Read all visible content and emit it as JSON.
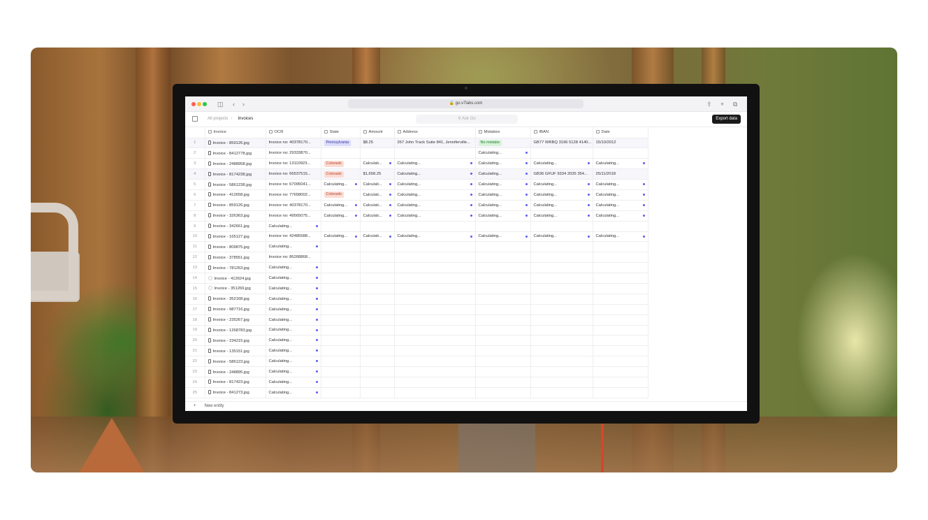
{
  "browser": {
    "url": "go.v7labs.com"
  },
  "app": {
    "breadcrumb": [
      "All projects",
      "Invoices"
    ],
    "ask_placeholder": "Ask Go",
    "export_label": "Export data",
    "new_entity_label": "New entity",
    "add_column": "+"
  },
  "columns": [
    "Invoice",
    "OCR",
    "State",
    "Amount",
    "Address",
    "Mistakes",
    "IBAN",
    "Date"
  ],
  "rows": [
    {
      "n": "1",
      "file": "Invoice - 859126.jpg",
      "ocr": "Invoice no: 40378170...",
      "state": "Pennsylvania",
      "amount": "$8.25",
      "address": "267 John Track Suite 841, Jenniferville...",
      "mistakes": "No mistake",
      "iban": "GB77 WRBQ 3196 5128 4140...",
      "date": "15/10/2012"
    },
    {
      "n": "2",
      "file": "Invoice - 8412778.jpg",
      "ocr": "Invoice no: 29333870...",
      "state": "",
      "amount": "",
      "address": "",
      "mistakes": "Calculating...",
      "iban": "",
      "date": ""
    },
    {
      "n": "3",
      "file": "Invoice - 2488958.jpg",
      "ocr": "Invoice no: 13110923...",
      "state": "Colorado",
      "amount": "Calculati...",
      "address": "Calculating...",
      "mistakes": "Calculating...",
      "iban": "Calculating...",
      "date": "Calculating..."
    },
    {
      "n": "4",
      "file": "Invoice - 8174238.jpg",
      "ocr": "Invoice no: 66537515...",
      "state": "Colorado",
      "amount": "$1,658.25",
      "address": "Calculating...",
      "mistakes": "Calculating...",
      "iban": "GB36 GFUF 9334 2035 354...",
      "date": "25/11/2018"
    },
    {
      "n": "5",
      "file": "Invoice - 5861238.jpg",
      "ocr": "Invoice no: 67095041...",
      "state": "Calculating...",
      "amount": "Calculati...",
      "address": "Calculating...",
      "mistakes": "Calculating...",
      "iban": "Calculating...",
      "date": "Calculating..."
    },
    {
      "n": "6",
      "file": "Invoice - 412658.jpg",
      "ocr": "Invoice no: 77658002...",
      "state": "Colorado",
      "amount": "Calculati...",
      "address": "Calculating...",
      "mistakes": "Calculating...",
      "iban": "Calculating...",
      "date": "Calculating..."
    },
    {
      "n": "7",
      "file": "Invoice - 859126.jpg",
      "ocr": "Invoice no: 40378170...",
      "state": "Calculating...",
      "amount": "Calculati...",
      "address": "Calculating...",
      "mistakes": "Calculating...",
      "iban": "Calculating...",
      "date": "Calculating..."
    },
    {
      "n": "8",
      "file": "Invoice - 326363.jpg",
      "ocr": "Invoice no: 49565075...",
      "state": "Calculating...",
      "amount": "Calculati...",
      "address": "Calculating...",
      "mistakes": "Calculating...",
      "iban": "Calculating...",
      "date": "Calculating..."
    },
    {
      "n": "9",
      "file": "Invoice - 342661.jpg",
      "ocr": "Calculating...",
      "state": "",
      "amount": "",
      "address": "",
      "mistakes": "",
      "iban": "",
      "date": ""
    },
    {
      "n": "10",
      "file": "Invoice - 165127.jpg",
      "ocr": "Invoice no: 42485588...",
      "state": "Calculating...",
      "amount": "Calculati...",
      "address": "Calculating...",
      "mistakes": "Calculating...",
      "iban": "Calculating...",
      "date": "Calculating..."
    },
    {
      "n": "11",
      "file": "Invoice - 809875.jpg",
      "ocr": "Calculating...",
      "state": "",
      "amount": "",
      "address": "",
      "mistakes": "",
      "iban": "",
      "date": ""
    },
    {
      "n": "12",
      "file": "Invoice - 378551.jpg",
      "ocr": "Invoice no: 86268868...",
      "state": "",
      "amount": "",
      "address": "",
      "mistakes": "",
      "iban": "",
      "date": ""
    },
    {
      "n": "13",
      "file": "Invoice - 781263.jpg",
      "ocr": "Calculating...",
      "state": "",
      "amount": "",
      "address": "",
      "mistakes": "",
      "iban": "",
      "date": ""
    },
    {
      "n": "14",
      "file": "Invoice - 412624.jpg",
      "ocr": "Calculating...",
      "state": "",
      "amount": "",
      "address": "",
      "mistakes": "",
      "iban": "",
      "date": ""
    },
    {
      "n": "15",
      "file": "Invoice - 351269.jpg",
      "ocr": "Calculating...",
      "state": "",
      "amount": "",
      "address": "",
      "mistakes": "",
      "iban": "",
      "date": ""
    },
    {
      "n": "16",
      "file": "Invoice - 352168.jpg",
      "ocr": "Calculating...",
      "state": "",
      "amount": "",
      "address": "",
      "mistakes": "",
      "iban": "",
      "date": ""
    },
    {
      "n": "17",
      "file": "Invoice - 987716.jpg",
      "ocr": "Calculating...",
      "state": "",
      "amount": "",
      "address": "",
      "mistakes": "",
      "iban": "",
      "date": ""
    },
    {
      "n": "18",
      "file": "Invoice - 235267.jpg",
      "ocr": "Calculating...",
      "state": "",
      "amount": "",
      "address": "",
      "mistakes": "",
      "iban": "",
      "date": ""
    },
    {
      "n": "19",
      "file": "Invoice - 1268783.jpg",
      "ocr": "Calculating...",
      "state": "",
      "amount": "",
      "address": "",
      "mistakes": "",
      "iban": "",
      "date": ""
    },
    {
      "n": "20",
      "file": "Invoice - 234215.jpg",
      "ocr": "Calculating...",
      "state": "",
      "amount": "",
      "address": "",
      "mistakes": "",
      "iban": "",
      "date": ""
    },
    {
      "n": "21",
      "file": "Invoice - 135151.jpg",
      "ocr": "Calculating...",
      "state": "",
      "amount": "",
      "address": "",
      "mistakes": "",
      "iban": "",
      "date": ""
    },
    {
      "n": "22",
      "file": "Invoice - 586123.jpg",
      "ocr": "Calculating...",
      "state": "",
      "amount": "",
      "address": "",
      "mistakes": "",
      "iban": "",
      "date": ""
    },
    {
      "n": "23",
      "file": "Invoice - 248895.jpg",
      "ocr": "Calculating...",
      "state": "",
      "amount": "",
      "address": "",
      "mistakes": "",
      "iban": "",
      "date": ""
    },
    {
      "n": "24",
      "file": "Invoice - 817423.jpg",
      "ocr": "Calculating...",
      "state": "",
      "amount": "",
      "address": "",
      "mistakes": "",
      "iban": "",
      "date": ""
    },
    {
      "n": "25",
      "file": "Invoice - 841273.jpg",
      "ocr": "Calculating...",
      "state": "",
      "amount": "",
      "address": "",
      "mistakes": "",
      "iban": "",
      "date": ""
    }
  ],
  "colors": {
    "accent_dot": "#5b5bf0",
    "state_tag": "#dcdcfb",
    "colorado_tag": "#fbdcd4",
    "ok_tag": "#d8f3da"
  }
}
